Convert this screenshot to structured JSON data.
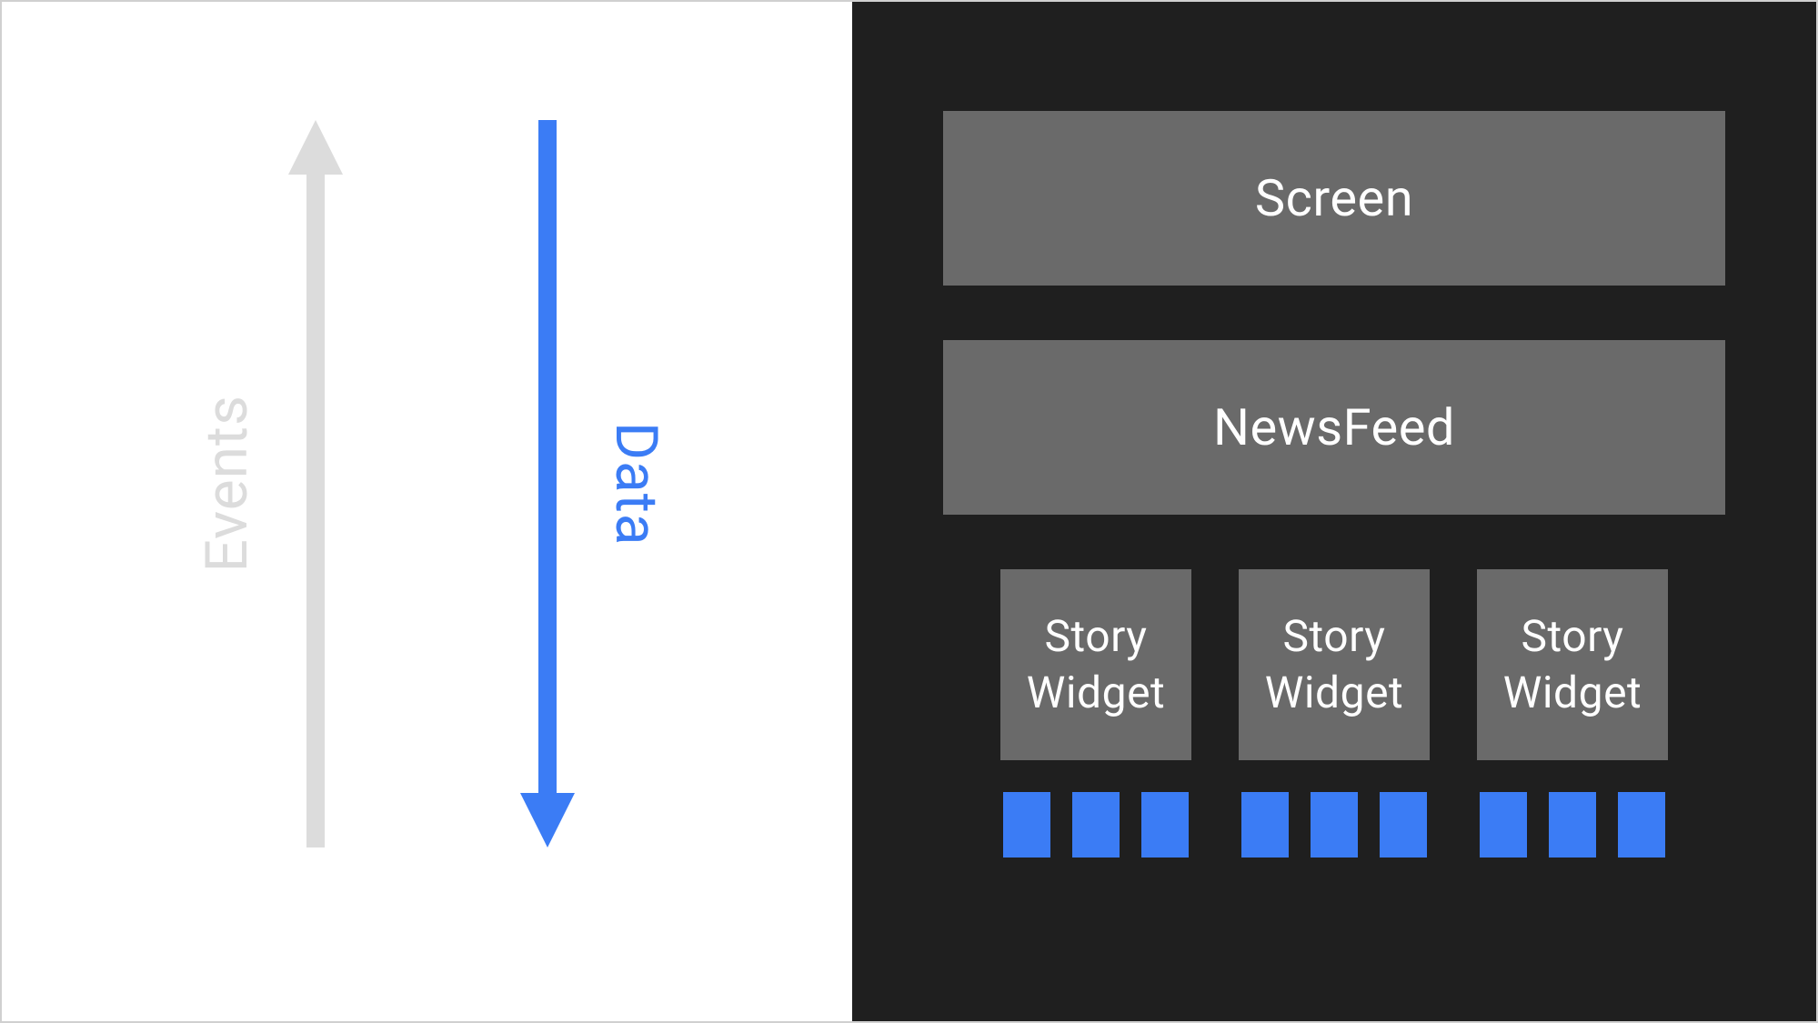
{
  "leftPanel": {
    "eventsLabel": "Events",
    "dataLabel": "Data"
  },
  "rightPanel": {
    "screenBox": "Screen",
    "newsFeedBox": "NewsFeed",
    "storyWidgets": [
      "Story\nWidget",
      "Story\nWidget",
      "Story\nWidget"
    ]
  },
  "colors": {
    "blue": "#3b7cf5",
    "lightGray": "#dcdcdc",
    "darkBg": "#1f1f1f",
    "boxGray": "#6a6a6a"
  }
}
